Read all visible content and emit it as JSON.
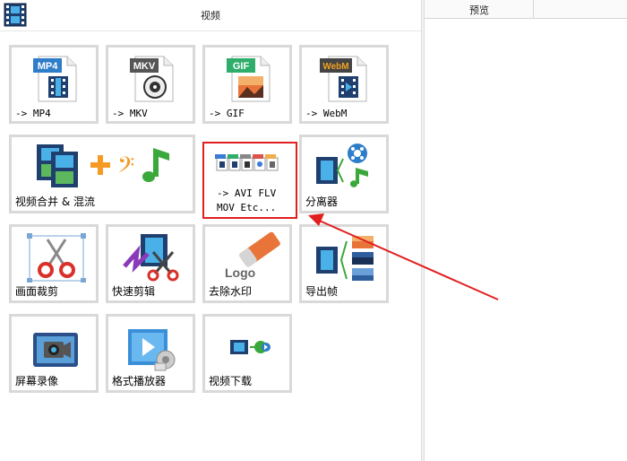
{
  "header": {
    "title": "视频"
  },
  "preview": {
    "label": "预览"
  },
  "tiles": {
    "mp4": {
      "badge": "MP4",
      "caption": "-> MP4",
      "color": "#2e7dc9"
    },
    "mkv": {
      "badge": "MKV",
      "caption": "-> MKV",
      "color": "#555555"
    },
    "gif": {
      "badge": "GIF",
      "caption": "-> GIF",
      "color": "#2eae6a"
    },
    "webm": {
      "badge": "WebM",
      "caption": "-> WebM",
      "color": "#e08a1e"
    },
    "merge": {
      "caption": "视频合并 & 混流"
    },
    "avi": {
      "caption_line1": "-> AVI FLV",
      "caption_line2": "MOV Etc..."
    },
    "splitter": {
      "caption": "分离器"
    },
    "crop": {
      "caption": "画面裁剪"
    },
    "quick_cut": {
      "caption": "快速剪辑"
    },
    "watermark": {
      "caption": "去除水印",
      "logo_text": "Logo"
    },
    "export_frames": {
      "caption": "导出帧"
    },
    "screen_record": {
      "caption": "屏幕录像"
    },
    "player": {
      "caption": "格式播放器"
    },
    "download": {
      "caption": "视频下载"
    }
  }
}
